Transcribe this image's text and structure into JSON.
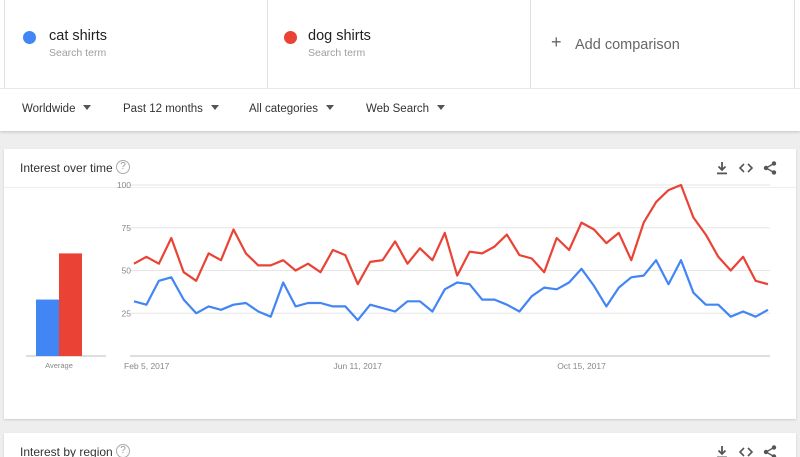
{
  "header": {
    "terms": [
      {
        "name": "cat shirts",
        "sub": "Search term",
        "color": "#4285f4"
      },
      {
        "name": "dog shirts",
        "sub": "Search term",
        "color": "#ea4335"
      }
    ],
    "add_comparison": "Add comparison"
  },
  "filters": {
    "geo": "Worldwide",
    "time": "Past 12 months",
    "category": "All categories",
    "property": "Web Search"
  },
  "interest_over_time": {
    "title": "Interest over time",
    "help": "?",
    "average_label": "Average"
  },
  "interest_by_region": {
    "title": "Interest by region",
    "help": "?"
  },
  "icons": [
    "download-icon",
    "embed-code-icon",
    "share-icon",
    "help-icon",
    "plus-icon",
    "caret-down-icon"
  ],
  "chart_data": {
    "type": "line",
    "title": "",
    "xlabel": "",
    "ylabel": "",
    "ylim": [
      0,
      100
    ],
    "yticks": [
      25,
      50,
      75,
      100
    ],
    "x_tick_labels": [
      {
        "label": "Feb 5, 2017",
        "index": 0
      },
      {
        "label": "Jun 11, 2017",
        "index": 18
      },
      {
        "label": "Oct 15, 2017",
        "index": 36
      }
    ],
    "grid": true,
    "series": [
      {
        "name": "cat shirts",
        "color": "#4285f4",
        "average": 33,
        "values": [
          32,
          30,
          44,
          46,
          33,
          25,
          29,
          27,
          30,
          31,
          26,
          23,
          43,
          29,
          31,
          31,
          29,
          29,
          21,
          30,
          28,
          26,
          32,
          32,
          26,
          39,
          43,
          42,
          33,
          33,
          30,
          26,
          35,
          40,
          39,
          43,
          51,
          41,
          29,
          40,
          46,
          47,
          56,
          42,
          56,
          37,
          30,
          30,
          23,
          26,
          23,
          27
        ]
      },
      {
        "name": "dog shirts",
        "color": "#ea4335",
        "average": 60,
        "values": [
          54,
          58,
          54,
          69,
          49,
          44,
          60,
          56,
          74,
          60,
          53,
          53,
          56,
          50,
          54,
          49,
          62,
          59,
          42,
          55,
          56,
          67,
          54,
          63,
          56,
          72,
          47,
          61,
          60,
          64,
          71,
          59,
          57,
          49,
          69,
          62,
          78,
          74,
          66,
          72,
          56,
          78,
          90,
          97,
          100,
          81,
          71,
          58,
          50,
          58,
          44,
          42
        ]
      }
    ]
  }
}
